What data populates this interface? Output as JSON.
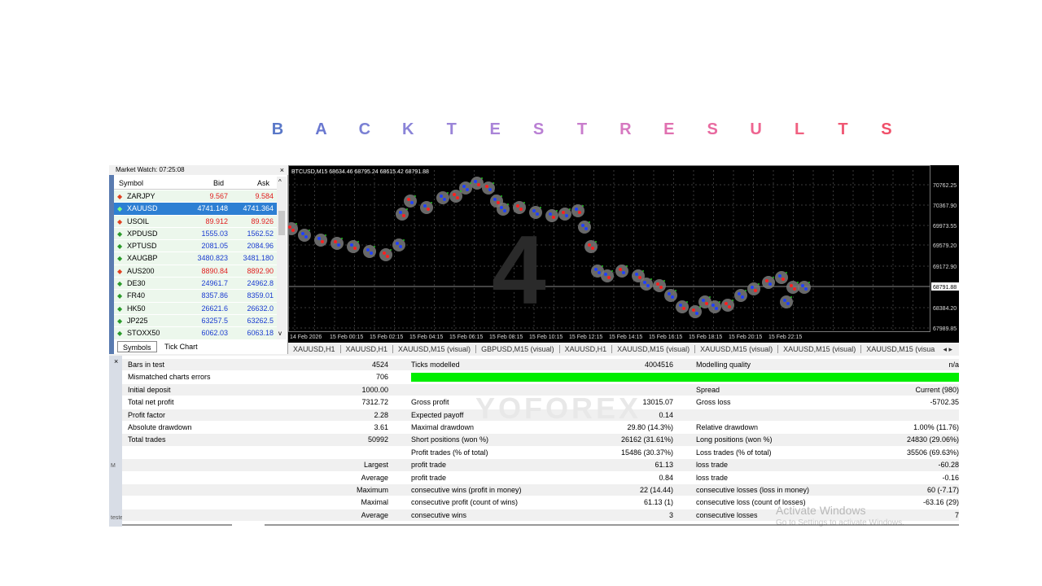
{
  "heading": {
    "letters": [
      {
        "ch": "B",
        "color": "#5a78c8"
      },
      {
        "ch": "A",
        "color": "#6a78d0"
      },
      {
        "ch": "C",
        "color": "#7a80d4"
      },
      {
        "ch": "K",
        "color": "#8a84d8"
      },
      {
        "ch": "T",
        "color": "#9a84d8"
      },
      {
        "ch": "E",
        "color": "#aa84d8"
      },
      {
        "ch": "S",
        "color": "#ba80d4"
      },
      {
        "ch": "T",
        "color": "#c87ccc"
      },
      {
        "ch": "R",
        "color": "#d678c0"
      },
      {
        "ch": "E",
        "color": "#e070b0"
      },
      {
        "ch": "S",
        "color": "#e86aa0"
      },
      {
        "ch": "U",
        "color": "#ee6490"
      },
      {
        "ch": "L",
        "color": "#f06080"
      },
      {
        "ch": "T",
        "color": "#f05874"
      },
      {
        "ch": "S",
        "color": "#f0506a"
      }
    ]
  },
  "market_watch": {
    "title": "Market Watch: 07:25:08",
    "close": "×",
    "columns": {
      "symbol": "Symbol",
      "bid": "Bid",
      "ask": "Ask"
    },
    "rows": [
      {
        "symbol": "ZARJPY",
        "bid": "9.567",
        "ask": "9.584",
        "dir": "down",
        "color": "#e02020",
        "selected": false
      },
      {
        "symbol": "XAUUSD",
        "bid": "4741.148",
        "ask": "4741.364",
        "dir": "up",
        "color": "#ffffff",
        "selected": true
      },
      {
        "symbol": "USOIL",
        "bid": "89.912",
        "ask": "89.926",
        "dir": "down",
        "color": "#e02020",
        "selected": false
      },
      {
        "symbol": "XPDUSD",
        "bid": "1555.03",
        "ask": "1562.52",
        "dir": "up",
        "color": "#1a3cd0",
        "selected": false
      },
      {
        "symbol": "XPTUSD",
        "bid": "2081.05",
        "ask": "2084.96",
        "dir": "up",
        "color": "#1a3cd0",
        "selected": false
      },
      {
        "symbol": "XAUGBP",
        "bid": "3480.823",
        "ask": "3481.180",
        "dir": "up",
        "color": "#1a3cd0",
        "selected": false
      },
      {
        "symbol": "AUS200",
        "bid": "8890.84",
        "ask": "8892.90",
        "dir": "down",
        "color": "#e02020",
        "selected": false
      },
      {
        "symbol": "DE30",
        "bid": "24961.7",
        "ask": "24962.8",
        "dir": "up",
        "color": "#1a3cd0",
        "selected": false
      },
      {
        "symbol": "FR40",
        "bid": "8357.86",
        "ask": "8359.01",
        "dir": "up",
        "color": "#1a3cd0",
        "selected": false
      },
      {
        "symbol": "HK50",
        "bid": "26621.6",
        "ask": "26632.0",
        "dir": "up",
        "color": "#1a3cd0",
        "selected": false
      },
      {
        "symbol": "JP225",
        "bid": "63257.5",
        "ask": "63262.5",
        "dir": "up",
        "color": "#1a3cd0",
        "selected": false
      },
      {
        "symbol": "STOXX50",
        "bid": "6062.03",
        "ask": "6063.18",
        "dir": "up",
        "color": "#1a3cd0",
        "selected": false
      }
    ],
    "tabs": {
      "symbols": "Symbols",
      "tick_chart": "Tick Chart"
    }
  },
  "chart": {
    "header": "BTCUSD,M15  68634.46 68795.24 68615.42 68791.88",
    "price_labels": [
      "70762.25",
      "70367.90",
      "69973.55",
      "69579.20",
      "69172.90",
      "68791.88",
      "68384.20",
      "67989.85"
    ],
    "time_labels": [
      "14 Feb 2026",
      "15 Feb 00:15",
      "15 Feb 02:15",
      "15 Feb 04:15",
      "15 Feb 06:15",
      "15 Feb 08:15",
      "15 Feb 10:15",
      "15 Feb 12:15",
      "15 Feb 14:15",
      "15 Feb 16:15",
      "15 Feb 18:15",
      "15 Feb 20:15",
      "15 Feb 22:15"
    ],
    "current_price": "68791.88"
  },
  "chart_tabs": [
    "XAUUSD,H1",
    "XAUUSD,H1",
    "XAUUSD,M15 (visual)",
    "GBPUSD,M15 (visual)",
    "XAUUSD,H1",
    "XAUUSD,M15 (visual)",
    "XAUUSD,M15 (visual)",
    "XAUUSD,M15 (visual)",
    "XAUUSD,M15 (visua"
  ],
  "chart_tabs_nav": "◂ ▸",
  "report": {
    "rows": [
      [
        "Bars in test",
        "4524",
        "Ticks modelled",
        "4004516",
        "Modelling quality",
        "n/a"
      ],
      [
        "Mismatched charts errors",
        "706",
        "",
        "",
        "",
        ""
      ],
      [
        "Initial deposit",
        "1000.00",
        "",
        "",
        "Spread",
        "Current (980)"
      ],
      [
        "Total net profit",
        "7312.72",
        "Gross profit",
        "13015.07",
        "Gross loss",
        "-5702.35"
      ],
      [
        "Profit factor",
        "2.28",
        "Expected payoff",
        "0.14",
        "",
        ""
      ],
      [
        "Absolute drawdown",
        "3.61",
        "Maximal drawdown",
        "29.80  (14.3%)",
        "Relative drawdown",
        "1.00% (11.76)"
      ],
      [
        "Total trades",
        "50992",
        "Short positions (won %)",
        "26162 (31.61%)",
        "Long positions (won %)",
        "24830 (29.06%)"
      ],
      [
        "",
        "",
        "Profit trades (% of total)",
        "15486 (30.37%)",
        "Loss trades (% of total)",
        "35506 (69.63%)"
      ],
      [
        "",
        "Largest",
        "profit trade",
        "61.13",
        "loss trade",
        "-60.28"
      ],
      [
        "",
        "Average",
        "profit trade",
        "0.84",
        "loss trade",
        "-0.16"
      ],
      [
        "",
        "Maximum",
        "consecutive wins (profit in money)",
        "22 (14.44)",
        "consecutive losses (loss in money)",
        "60 (-7.17)"
      ],
      [
        "",
        "Maximal",
        "consecutive profit (count of wins)",
        "61.13 (1)",
        "consecutive loss (count of losses)",
        "-63.16 (29)"
      ],
      [
        "",
        "Average",
        "consecutive wins",
        "3",
        "consecutive losses",
        "7"
      ]
    ],
    "modelling_quality_bar": 1.0,
    "watermark": "Activate Windows",
    "watermark_sub": "Go to Settings to activate Windows.",
    "logo_text": "YOFOREX",
    "left_labels": [
      "M",
      "tester"
    ]
  }
}
